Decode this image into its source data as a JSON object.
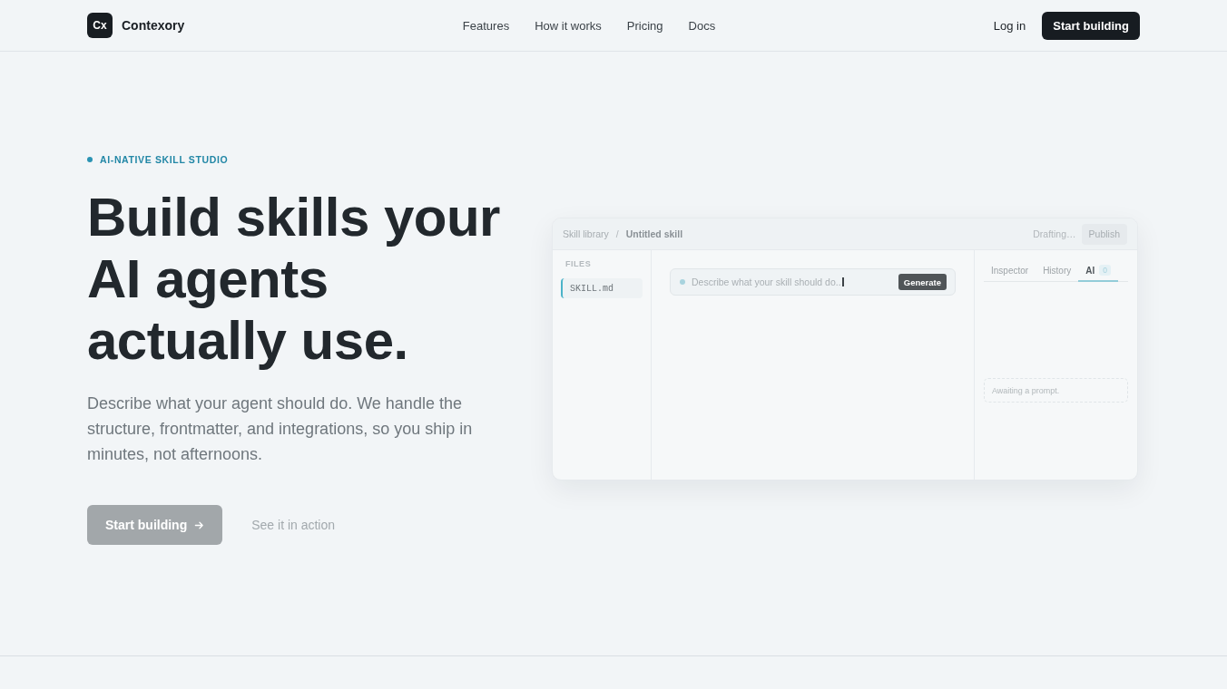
{
  "header": {
    "logo": {
      "mark": "Cx",
      "name": "Contexory"
    },
    "nav": [
      {
        "label": "Features"
      },
      {
        "label": "How it works"
      },
      {
        "label": "Pricing"
      },
      {
        "label": "Docs"
      }
    ],
    "login": "Log in",
    "cta": "Start building"
  },
  "hero": {
    "eyebrow": "AI-NATIVE SKILL STUDIO",
    "headline": "Build skills your AI agents actually use.",
    "description": "Describe what your agent should do. We handle the structure, frontmatter, and integrations, so you ship in minutes, not afternoons.",
    "actions": [
      {
        "kind": "primary",
        "label": "Start building"
      },
      {
        "kind": "link",
        "label": "See it in action"
      }
    ]
  },
  "preview": {
    "breadcrumb": {
      "separator": "/",
      "items": [
        {
          "label": "Skill library",
          "current": false
        },
        {
          "label": "Untitled skill",
          "current": true
        }
      ]
    },
    "status": "Drafting…",
    "publish": "Publish",
    "files": {
      "heading": "FILES",
      "items": [
        {
          "name": "SKILL.md",
          "selected": true
        }
      ]
    },
    "prompt": {
      "value": "Describe what your skill should do..",
      "button": "Generate"
    },
    "tabs": [
      {
        "label": "Inspector",
        "selected": false
      },
      {
        "label": "History",
        "selected": false
      },
      {
        "label": "AI",
        "selected": true,
        "badge": "0"
      }
    ],
    "empty_state": "Awaiting a prompt."
  }
}
